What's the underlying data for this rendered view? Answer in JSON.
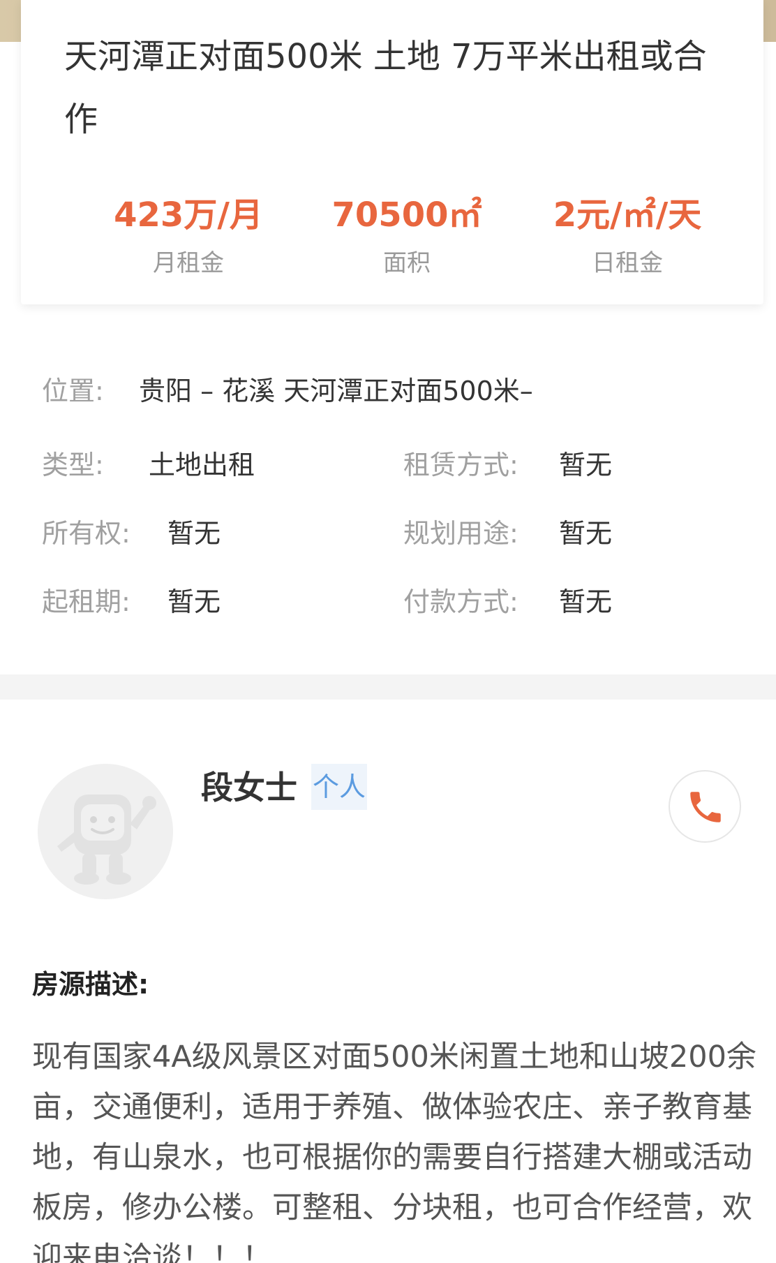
{
  "listing": {
    "title": "天河潭正对面500米 土地 7万平米出租或合作",
    "stats": [
      {
        "value": "423万/月",
        "label": "月租金"
      },
      {
        "value": "70500㎡",
        "label": "面积"
      },
      {
        "value": "2元/㎡/天",
        "label": "日租金"
      }
    ]
  },
  "info": {
    "location_label": "位置:",
    "location_value": "贵阳 – 花溪 天河潭正对面500米–",
    "type_label": "类型:",
    "type_value": "土地出租",
    "lease_method_label": "租赁方式:",
    "lease_method_value": "暂无",
    "ownership_label": "所有权:",
    "ownership_value": "暂无",
    "planned_use_label": "规划用途:",
    "planned_use_value": "暂无",
    "lease_start_label": "起租期:",
    "lease_start_value": "暂无",
    "payment_label": "付款方式:",
    "payment_value": "暂无"
  },
  "agent": {
    "name": "段女士",
    "tag": "个人",
    "call_icon": "phone-icon",
    "avatar_icon": "mascot-avatar-icon"
  },
  "description": {
    "title": "房源描述:",
    "body": "现有国家4A级风景区对面500米闲置土地和山坡200余亩，交通便利，适用于养殖、做体验农庄、亲子教育基地，有山泉水，也可根据你的需要自行搭建大棚或活动板房，修办公楼。可整租、分块租，也可合作经营，欢迎来电洽谈！！！"
  },
  "colors": {
    "accent": "#e8663e",
    "label_gray": "#a0a0a0",
    "tag_blue": "#5b9be0"
  }
}
